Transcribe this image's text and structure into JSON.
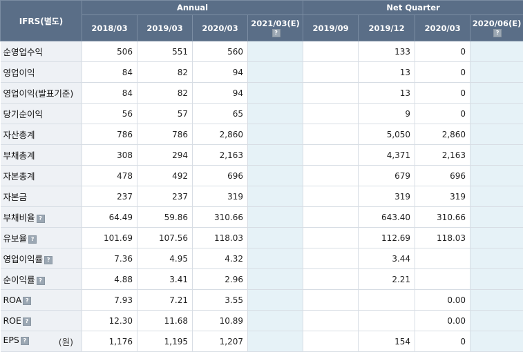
{
  "header": {
    "corner": "IFRS(별도)",
    "groups": [
      "Annual",
      "Net Quarter"
    ],
    "columns": [
      "2018/03",
      "2019/03",
      "2020/03",
      "2021/03(E)",
      "2019/09",
      "2019/12",
      "2020/03",
      "2020/06(E)"
    ],
    "help_glyph": "?"
  },
  "rows": [
    {
      "label": "순영업수익",
      "values": [
        "506",
        "551",
        "560",
        "",
        "",
        "133",
        "0",
        ""
      ]
    },
    {
      "label": "영업이익",
      "values": [
        "84",
        "82",
        "94",
        "",
        "",
        "13",
        "0",
        ""
      ]
    },
    {
      "label": "영업이익(발표기준)",
      "values": [
        "84",
        "82",
        "94",
        "",
        "",
        "13",
        "0",
        ""
      ]
    },
    {
      "label": "당기순이익",
      "values": [
        "56",
        "57",
        "65",
        "",
        "",
        "9",
        "0",
        ""
      ]
    },
    {
      "label": "자산총계",
      "values": [
        "786",
        "786",
        "2,860",
        "",
        "",
        "5,050",
        "2,860",
        ""
      ]
    },
    {
      "label": "부채총계",
      "values": [
        "308",
        "294",
        "2,163",
        "",
        "",
        "4,371",
        "2,163",
        ""
      ]
    },
    {
      "label": "자본총계",
      "values": [
        "478",
        "492",
        "696",
        "",
        "",
        "679",
        "696",
        ""
      ]
    },
    {
      "label": "자본금",
      "values": [
        "237",
        "237",
        "319",
        "",
        "",
        "319",
        "319",
        ""
      ]
    },
    {
      "label": "부채비율",
      "values": [
        "64.49",
        "59.86",
        "310.66",
        "",
        "",
        "643.40",
        "310.66",
        ""
      ]
    },
    {
      "label": "유보율",
      "values": [
        "101.69",
        "107.56",
        "118.03",
        "",
        "",
        "112.69",
        "118.03",
        ""
      ]
    },
    {
      "label": "영업이익률",
      "values": [
        "7.36",
        "4.95",
        "4.32",
        "",
        "",
        "3.44",
        "",
        ""
      ]
    },
    {
      "label": "순이익률",
      "values": [
        "4.88",
        "3.41",
        "2.96",
        "",
        "",
        "2.21",
        "",
        ""
      ]
    },
    {
      "label": "ROA",
      "values": [
        "7.93",
        "7.21",
        "3.55",
        "",
        "",
        "",
        "0.00",
        ""
      ]
    },
    {
      "label": "ROE",
      "values": [
        "12.30",
        "11.68",
        "10.89",
        "",
        "",
        "",
        "0.00",
        ""
      ]
    },
    {
      "label": "EPS",
      "unit": "(원)",
      "values": [
        "1,176",
        "1,195",
        "1,207",
        "",
        "",
        "154",
        "0",
        ""
      ]
    }
  ],
  "colors": {
    "header_bg": "#5a6e87",
    "estimate_bg": "#e6f2f7",
    "label_bg": "#eef1f5"
  }
}
